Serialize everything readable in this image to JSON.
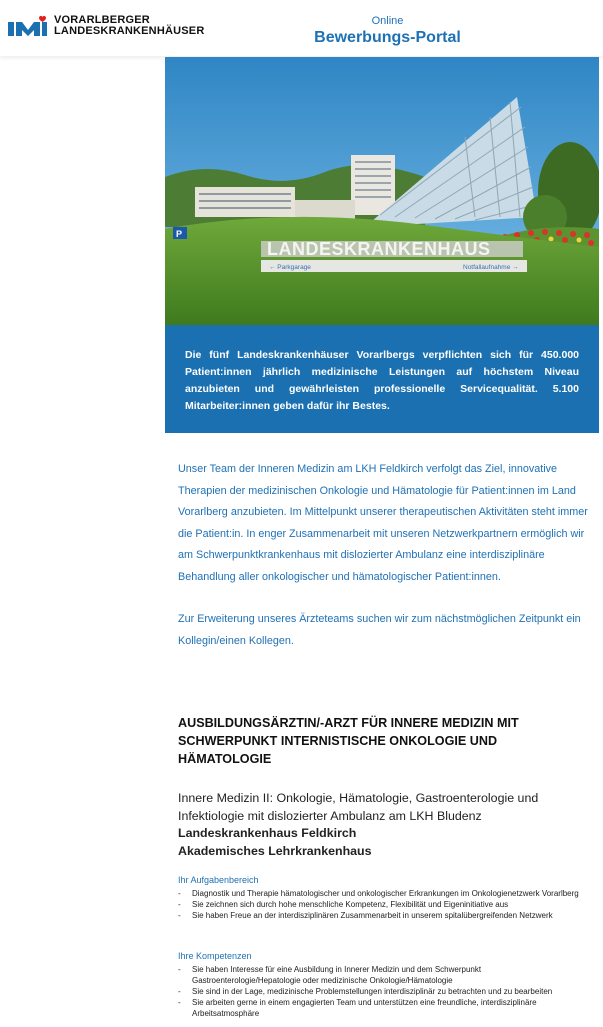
{
  "header": {
    "logo_line1": "VORARLBERGER",
    "logo_line2": "LANDESKRANKENHÄUSER",
    "portal_small": "Online",
    "portal_big": "Bewerbungs-Portal"
  },
  "hero": {
    "sign_text": "LANDESKRANKENHAUS",
    "sign_left": "← Parkgarage",
    "sign_right": "Notfallaufnahme →"
  },
  "bluebox": {
    "text": "Die fünf Landeskrankenhäuser Vorarlbergs verpflichten sich für 450.000 Patient:innen jährlich medizinische Leistungen auf höchstem Niveau anzubieten und gewährleisten professionelle Servicequalität. 5.100 Mitarbeiter:innen geben dafür ihr Bestes."
  },
  "intro": {
    "para1": "Unser Team der Inneren Medizin am LKH Feldkirch verfolgt das Ziel, innovative Therapien der medizinischen Onkologie und Hämatologie für Patient:innen im Land Vorarlberg anzubieten. Im Mittelpunkt unserer therapeutischen Aktivitäten steht immer die Patient:in. In enger Zusammenarbeit mit unseren Netzwerkpartnern ermöglich wir am Schwerpunktkrankenhaus mit dislozierter Ambulanz eine interdisziplinäre Behandlung aller onkologischer und hämatologischer Patient:innen.",
    "para2": "Zur Erweiterung unseres Ärzteteams suchen wir zum nächstmöglichen Zeitpunkt ein Kollegin/einen Kollegen."
  },
  "job": {
    "title": "AUSBILDUNGSÄRZTIN/-ARZT FÜR INNERE MEDIZIN MIT SCHWERPUNKT INTERNISTISCHE ONKOLOGIE UND HÄMATOLOGIE",
    "dept_line1": "Innere Medizin II: Onkologie, Hämatologie, Gastroenterologie und Infektiologie mit dislozierter Ambulanz am LKH Bludenz",
    "hospital": "Landeskrankenhaus Feldkirch",
    "academic": "Akademisches Lehrkrankenhaus"
  },
  "tasks": {
    "heading": "Ihr Aufgabenbereich",
    "items": [
      "Diagnostik und Therapie hämatologischer und onkologischer Erkrankungen im Onkologienetzwerk Vorarlberg",
      "Sie zeichnen sich durch hohe menschliche Kompetenz, Flexibilität und Eigeninitiative aus",
      "Sie haben Freue an der interdisziplinären Zusammenarbeit in unserem spitalübergreifenden Netzwerk"
    ]
  },
  "skills": {
    "heading": "Ihre Kompetenzen",
    "items": [
      "Sie haben Interesse für eine Ausbildung in Innerer Medizin und dem Schwerpunkt Gastroenterologie/Hepatologie oder medizinische Onkologie/Hämatologie",
      "Sie sind in der Lage, medizinische Problemstellungen interdisziplinär zu betrachten und zu bearbeiten",
      "Sie arbeiten gerne in einem engagierten Team und unterstützen eine freundliche, interdisziplinäre Arbeitsatmosphäre"
    ]
  },
  "colors": {
    "brand_blue": "#1a70b0",
    "logo_red": "#e2211c"
  }
}
